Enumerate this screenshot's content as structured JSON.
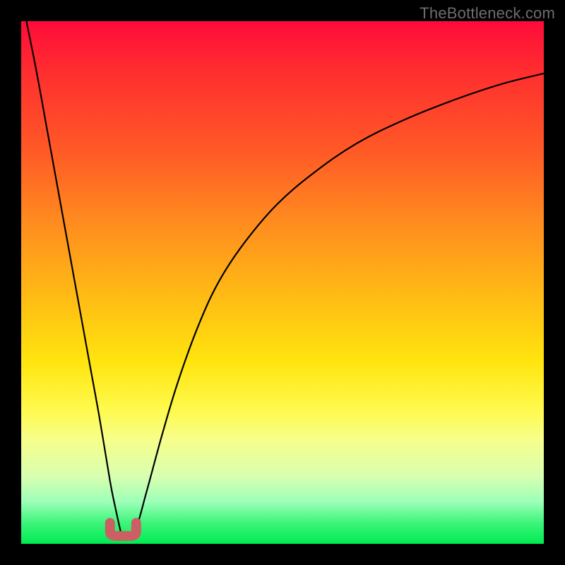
{
  "attribution": "TheBottleneck.com",
  "colors": {
    "page_bg": "#000000",
    "gradient_top": "#ff0b3a",
    "gradient_bottom": "#00eb52",
    "curve_stroke": "#000000",
    "marker_stroke": "#cc5f64",
    "attribution_text": "#6d6d6d"
  },
  "chart_data": {
    "type": "line",
    "title": "",
    "xlabel": "",
    "ylabel": "",
    "xlim": [
      0,
      100
    ],
    "ylim": [
      0,
      100
    ],
    "grid": false,
    "legend": false,
    "background": "gradient red→green (top→bottom)",
    "annotations": [
      {
        "text": "TheBottleneck.com",
        "position": "top-right"
      },
      {
        "shape": "U-marker",
        "approx_x_range": [
          17,
          22
        ],
        "approx_y": 1.5,
        "color": "#cc5f64"
      }
    ],
    "series": [
      {
        "name": "left-branch",
        "x": [
          1,
          3,
          5,
          7,
          9,
          11,
          13,
          15,
          17,
          18,
          19,
          19.5
        ],
        "y": [
          100,
          90,
          79,
          68,
          57,
          46,
          35,
          24,
          12,
          7,
          2.5,
          1
        ]
      },
      {
        "name": "right-branch",
        "x": [
          20.5,
          22,
          24,
          27,
          30,
          34,
          38,
          43,
          49,
          56,
          64,
          73,
          83,
          92,
          100
        ],
        "y": [
          1,
          3,
          10,
          21,
          31,
          42,
          50.5,
          58,
          65,
          71,
          76.5,
          81,
          85,
          88,
          90
        ]
      }
    ],
    "minimum": {
      "x": 20,
      "y": 1
    }
  }
}
